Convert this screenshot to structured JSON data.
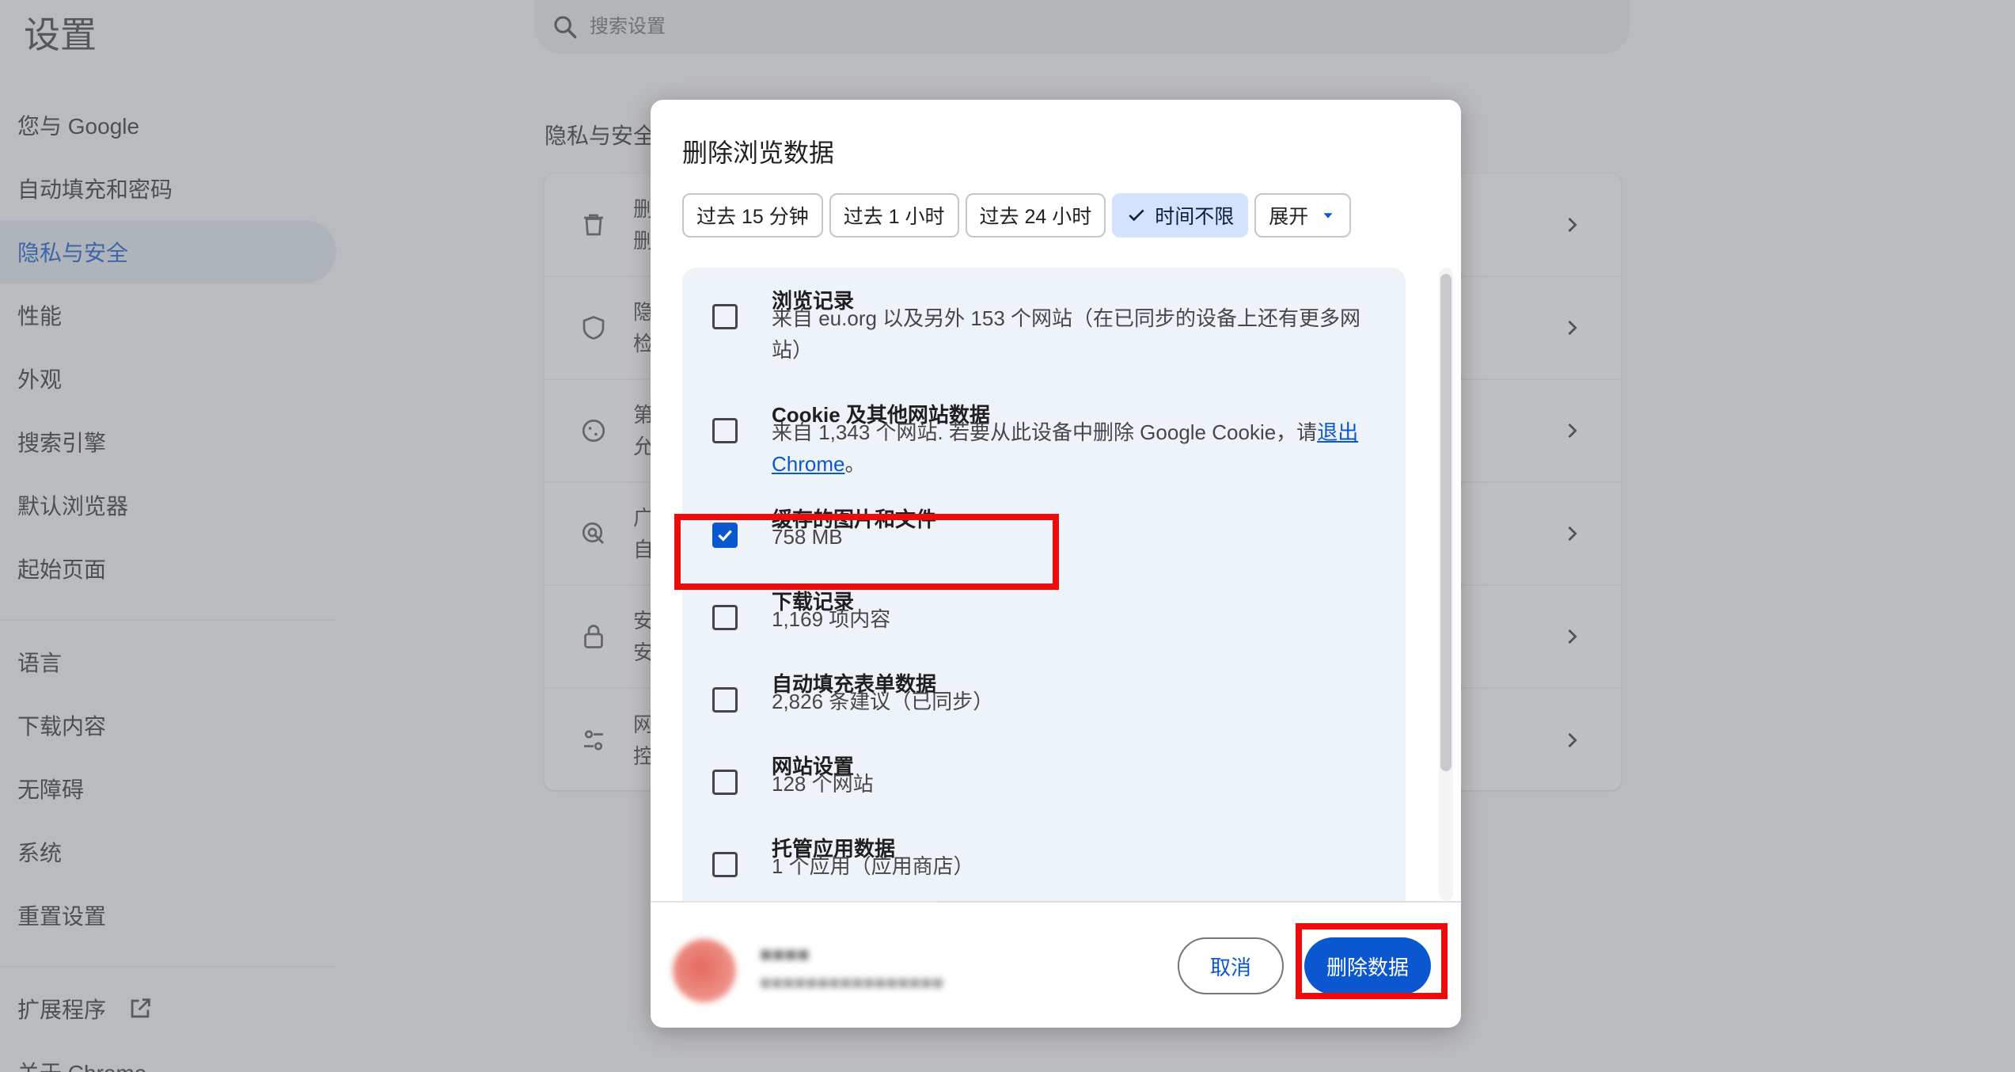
{
  "page": {
    "title": "设置",
    "search_placeholder": "搜索设置"
  },
  "sidebar": {
    "items": [
      {
        "label": "您与 Google"
      },
      {
        "label": "自动填充和密码"
      },
      {
        "label": "隐私与安全",
        "active": true
      },
      {
        "label": "性能"
      },
      {
        "label": "外观"
      },
      {
        "label": "搜索引擎"
      },
      {
        "label": "默认浏览器"
      },
      {
        "label": "起始页面"
      },
      {
        "label": "语言"
      },
      {
        "label": "下载内容"
      },
      {
        "label": "无障碍"
      },
      {
        "label": "系统"
      },
      {
        "label": "重置设置"
      },
      {
        "label": "扩展程序"
      },
      {
        "label": "关于 Chrome"
      }
    ]
  },
  "main": {
    "section_title": "隐私与安全",
    "rows": [
      {
        "icon": "trash-icon",
        "line1": "删",
        "line2": "删"
      },
      {
        "icon": "shield-check-icon",
        "line1": "隐",
        "line2": "检"
      },
      {
        "icon": "cookie-icon",
        "line1": "第",
        "line2": "允"
      },
      {
        "icon": "ad-target-icon",
        "line1": "广",
        "line2": "自"
      },
      {
        "icon": "lock-icon",
        "line1": "安",
        "line2": "安"
      },
      {
        "icon": "tune-icon",
        "line1": "网",
        "line2": "控"
      }
    ]
  },
  "dialog": {
    "title": "删除浏览数据",
    "chips": [
      {
        "label": "过去 15 分钟",
        "selected": false
      },
      {
        "label": "过去 1 小时",
        "selected": false
      },
      {
        "label": "过去 24 小时",
        "selected": false
      },
      {
        "label": "时间不限",
        "selected": true
      },
      {
        "label": "展开",
        "selected": false
      }
    ],
    "items": [
      {
        "title": "浏览记录",
        "desc": "来自 eu.org 以及另外 153 个网站（在已同步的设备上还有更多网站）",
        "checked": false
      },
      {
        "title": "Cookie 及其他网站数据",
        "desc_prefix": "来自 1,343 个网站. 若要从此设备中删除 Google Cookie，请",
        "desc_link": "退出 Chrome",
        "desc_suffix": "。",
        "checked": false
      },
      {
        "title": "缓存的图片和文件",
        "desc": "758 MB",
        "checked": true
      },
      {
        "title": "下载记录",
        "desc": "1,169 项内容",
        "checked": false
      },
      {
        "title": "自动填充表单数据",
        "desc": "2,826 条建议（已同步）",
        "checked": false
      },
      {
        "title": "网站设置",
        "desc": "128 个网站",
        "checked": false
      },
      {
        "title": "托管应用数据",
        "desc": "1 个应用（应用商店）",
        "checked": false
      }
    ],
    "cancel_label": "取消",
    "delete_label": "删除数据"
  },
  "colors": {
    "accent": "#0b57d0",
    "highlight": "#ef0b0b",
    "chip_selected_bg": "#d3e3fd",
    "list_bg": "#eef2f9"
  }
}
